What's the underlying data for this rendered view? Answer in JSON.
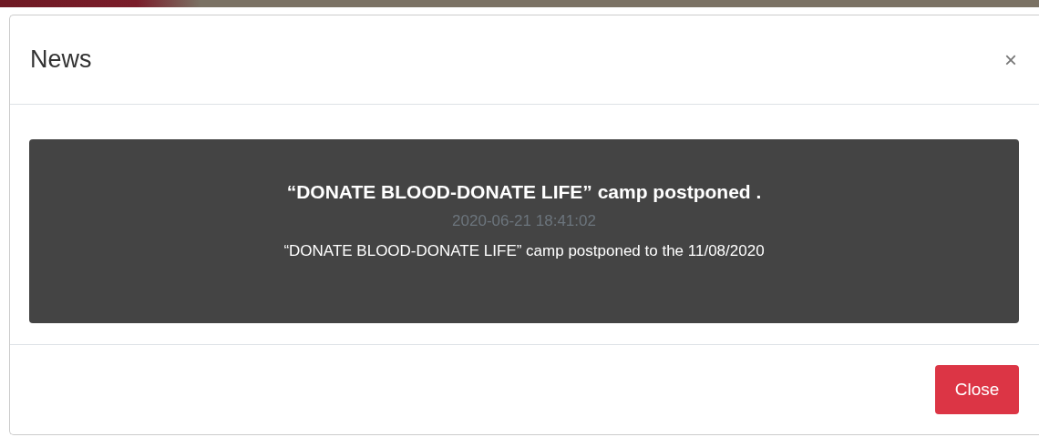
{
  "modal": {
    "title": "News",
    "close_icon": "×"
  },
  "news": [
    {
      "headline": "“DONATE BLOOD-DONATE LIFE” camp postponed .",
      "date": "2020-06-21 18:41:02",
      "text": "“DONATE BLOOD-DONATE LIFE” camp postponed to the 11/08/2020"
    }
  ],
  "buttons": [
    {
      "label": "Close",
      "kind": "danger"
    }
  ]
}
